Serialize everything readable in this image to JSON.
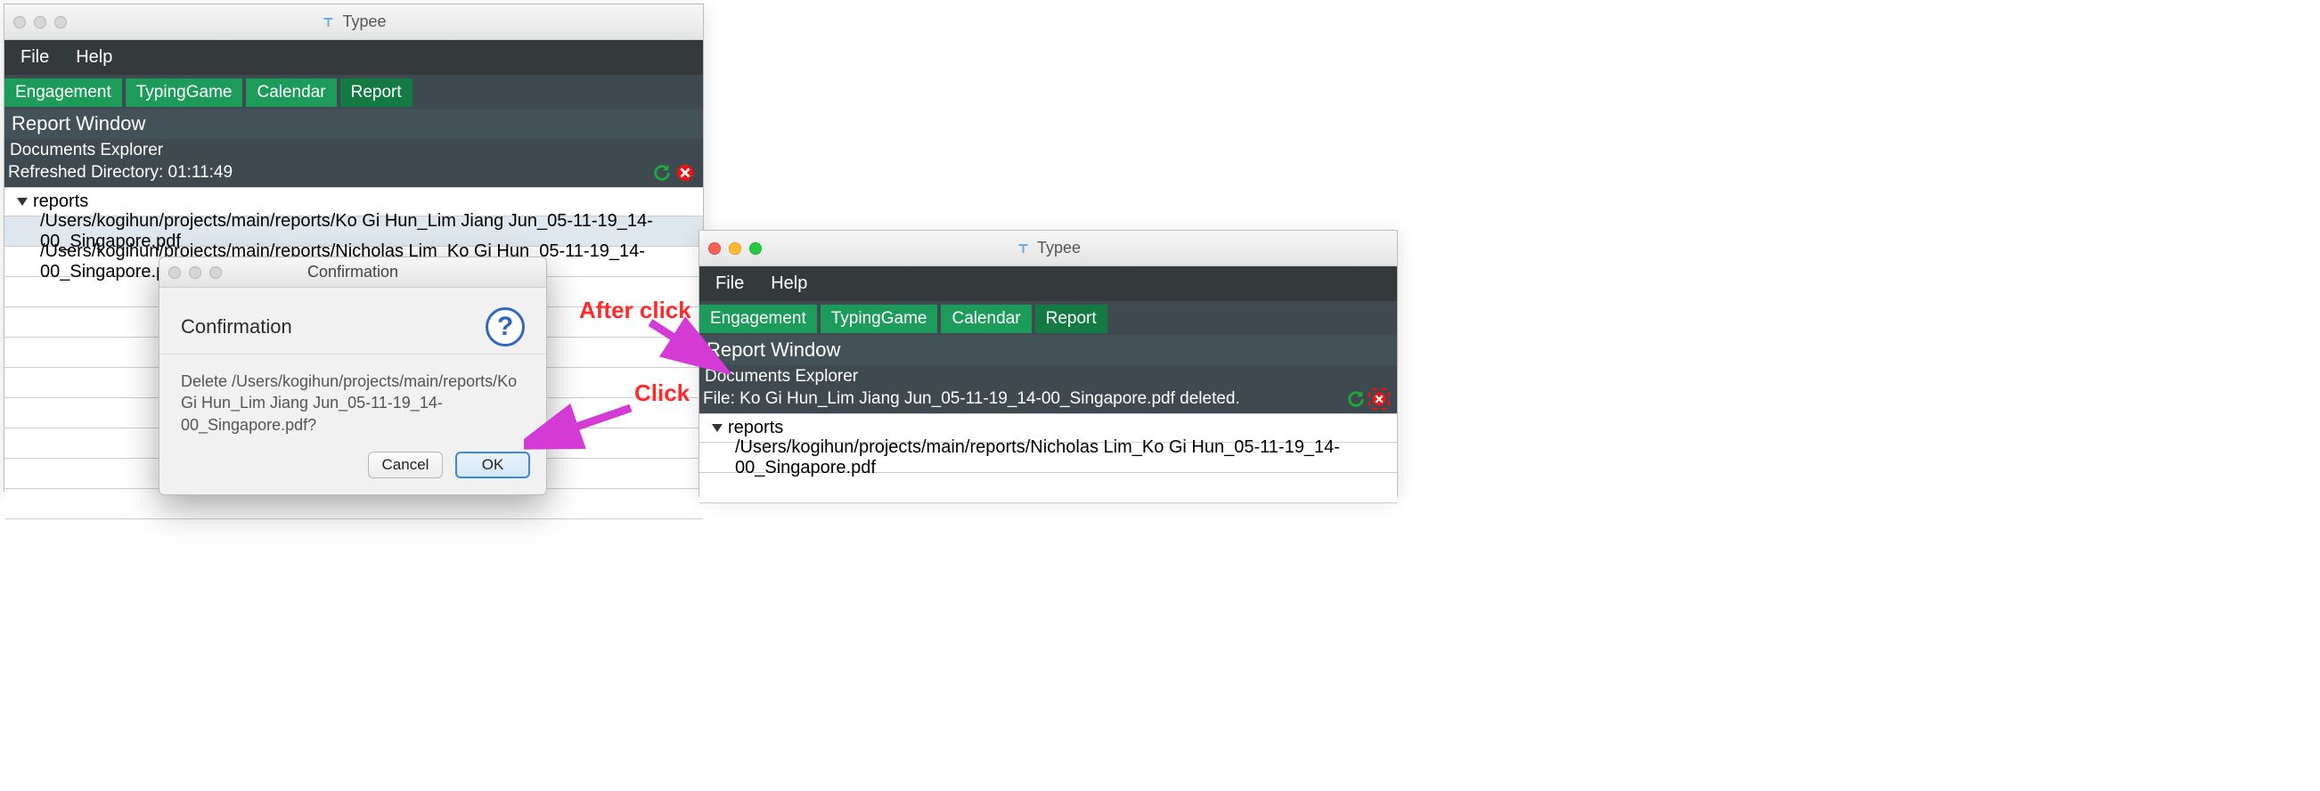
{
  "left": {
    "app_title": "Typee",
    "menubar": {
      "file": "File",
      "help": "Help"
    },
    "tabs": {
      "engagement": "Engagement",
      "typing": "TypingGame",
      "calendar": "Calendar",
      "report": "Report"
    },
    "section_title": "Report Window",
    "sub_title": "Documents Explorer",
    "refreshed": "Refreshed Directory: 01:11:49",
    "tree_header": "reports",
    "rows": {
      "r0": "/Users/kogihun/projects/main/reports/Ko Gi Hun_Lim Jiang Jun_05-11-19_14-00_Singapore.pdf",
      "r1": "/Users/kogihun/projects/main/reports/Nicholas Lim_Ko Gi Hun_05-11-19_14-00_Singapore.pdf"
    },
    "dialog": {
      "window_title": "Confirmation",
      "heading": "Confirmation",
      "message": "Delete /Users/kogihun/projects/main/reports/Ko Gi Hun_Lim Jiang Jun_05-11-19_14-00_Singapore.pdf?",
      "cancel": "Cancel",
      "ok": "OK"
    }
  },
  "right": {
    "app_title": "Typee",
    "menubar": {
      "file": "File",
      "help": "Help"
    },
    "tabs": {
      "engagement": "Engagement",
      "typing": "TypingGame",
      "calendar": "Calendar",
      "report": "Report"
    },
    "section_title": "Report Window",
    "sub_title": "Documents Explorer",
    "status": "File: Ko Gi Hun_Lim Jiang Jun_05-11-19_14-00_Singapore.pdf deleted.",
    "tree_header": "reports",
    "rows": {
      "r0": "/Users/kogihun/projects/main/reports/Nicholas Lim_Ko Gi Hun_05-11-19_14-00_Singapore.pdf"
    }
  },
  "annotations": {
    "after_click": "After click",
    "click": "Click"
  }
}
